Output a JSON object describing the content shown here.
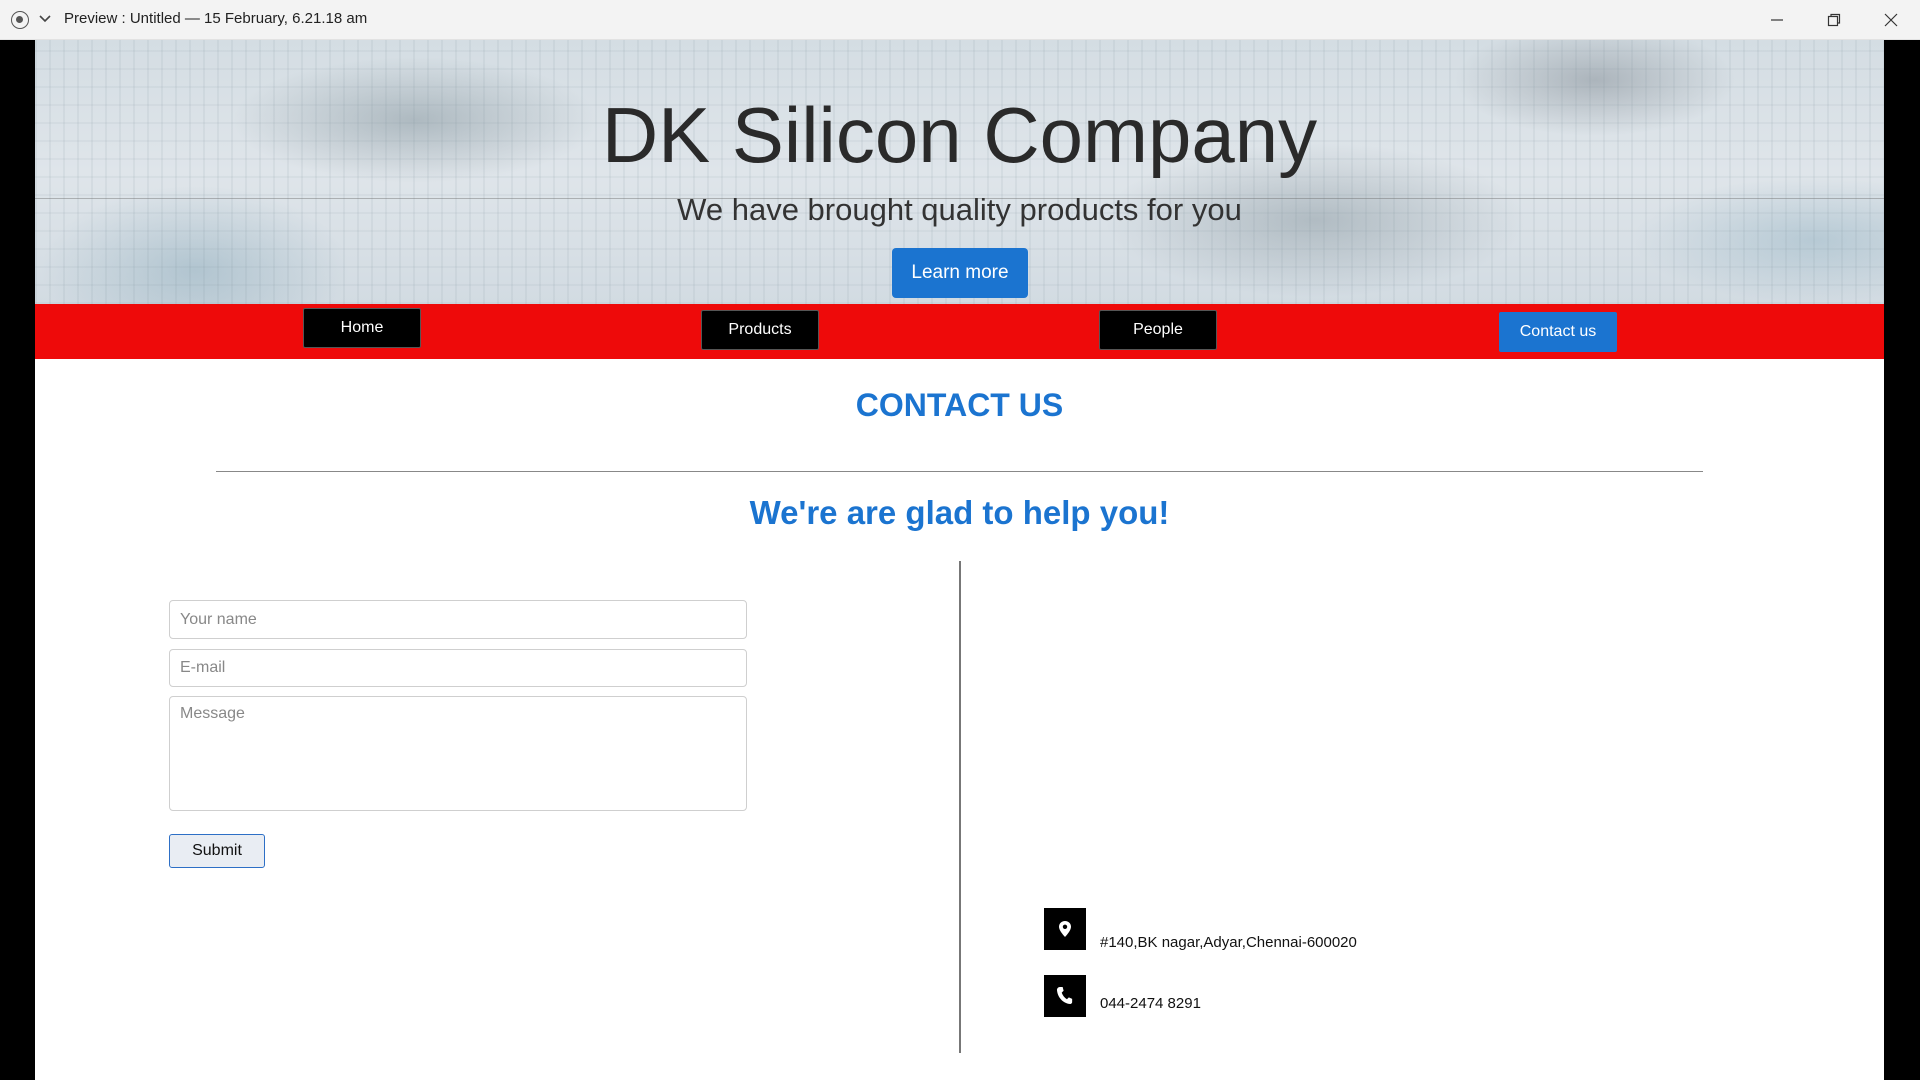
{
  "window": {
    "title": "Preview : Untitled — 15 February, 6.21.18 am",
    "icons": [
      "app-icon",
      "chevron-down-icon",
      "minimize-icon",
      "maximize-icon",
      "close-icon"
    ]
  },
  "hero": {
    "title": "DK Silicon Company",
    "subtitle": "We have brought quality products for you",
    "learn_more": "Learn more"
  },
  "nav": {
    "items": [
      {
        "label": "Home"
      },
      {
        "label": "Products"
      },
      {
        "label": "People"
      },
      {
        "label": "Contact us",
        "active": true
      }
    ],
    "background": "#ee0a0a",
    "active_color": "#1b74d0"
  },
  "contact": {
    "title": "CONTACT US",
    "subtitle": "We're are glad to help you!",
    "form": {
      "name_placeholder": "Your name",
      "email_placeholder": "E-mail",
      "message_placeholder": "Message",
      "submit": "Submit"
    },
    "info": {
      "address": "#140,BK nagar,Adyar,Chennai-600020",
      "phone": "044-2474 8291",
      "icons": [
        "map-marker-icon",
        "phone-icon"
      ]
    }
  },
  "colors": {
    "accent": "#1b74d0",
    "nav_button": "#000000"
  }
}
